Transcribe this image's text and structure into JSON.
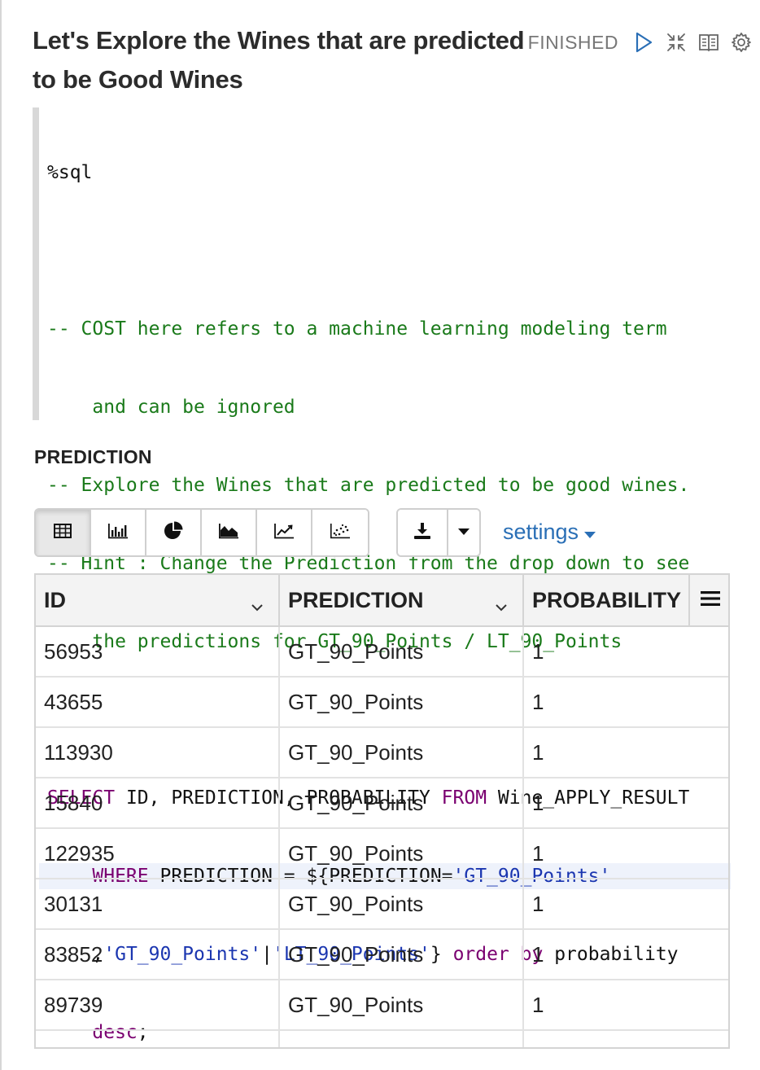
{
  "paragraph": {
    "title": "Let's Explore the Wines that are predicted to be Good Wines",
    "status": "FINISHED",
    "icons": [
      "run-icon",
      "collapse-icon",
      "book-icon",
      "gear-icon"
    ]
  },
  "editor": {
    "lines": [
      {
        "type": "plain",
        "text": "%sql"
      },
      {
        "type": "plain",
        "text": ""
      },
      {
        "type": "comment",
        "text": "-- COST here refers to a machine learning modeling term"
      },
      {
        "type": "comment",
        "text": "    and can be ignored"
      },
      {
        "type": "comment",
        "text": "-- Explore the Wines that are predicted to be good wines."
      },
      {
        "type": "comment",
        "text": "-- Hint : Change the Prediction from the drop down to see"
      },
      {
        "type": "comment",
        "text": "    the predictions for GT_90_Points / LT_90_Points"
      },
      {
        "type": "plain",
        "text": ""
      }
    ],
    "sql": {
      "l1_kw1": "SELECT",
      "l1_t1": " ID, PREDICTION, PROBABILITY ",
      "l1_kw2": "FROM",
      "l1_t2": " Wine_APPLY_RESULT",
      "l2_indent": "    ",
      "l2_kw": "WHERE",
      "l2_t1": " PREDICTION = ${PREDICTION=",
      "l2_str": "'GT_90_Points'",
      "l3_indent": "    ,",
      "l3_str1": "'GT_90_Points'",
      "l3_pipe": "|",
      "l3_str2": "'LT_90_Points'",
      "l3_t1": "} ",
      "l3_kw": "order by",
      "l3_t2": " probability",
      "l4_indent": "    ",
      "l4_kw": "desc",
      "l4_t": ";"
    }
  },
  "form": {
    "prediction_label": "PREDICTION"
  },
  "toolbar": {
    "viz_icons": [
      "table-icon",
      "bar-chart-icon",
      "pie-chart-icon",
      "area-chart-icon",
      "line-chart-icon",
      "scatter-chart-icon"
    ],
    "active_viz": "table-icon",
    "settings_label": "settings"
  },
  "table": {
    "columns": [
      "ID",
      "PREDICTION",
      "PROBABILITY"
    ],
    "rows": [
      [
        "56953",
        "GT_90_Points",
        "1"
      ],
      [
        "43655",
        "GT_90_Points",
        "1"
      ],
      [
        "113930",
        "GT_90_Points",
        "1"
      ],
      [
        "15840",
        "GT_90_Points",
        "1"
      ],
      [
        "122935",
        "GT_90_Points",
        "1"
      ],
      [
        "30131",
        "GT_90_Points",
        "1"
      ],
      [
        "83852",
        "GT_90_Points",
        "1"
      ],
      [
        "89739",
        "GT_90_Points",
        "1"
      ]
    ]
  },
  "colors": {
    "comment": "#1a7a1a",
    "keyword": "#7a0070",
    "string": "#1b36b0",
    "link": "#2a6fb6",
    "status": "#777777"
  }
}
